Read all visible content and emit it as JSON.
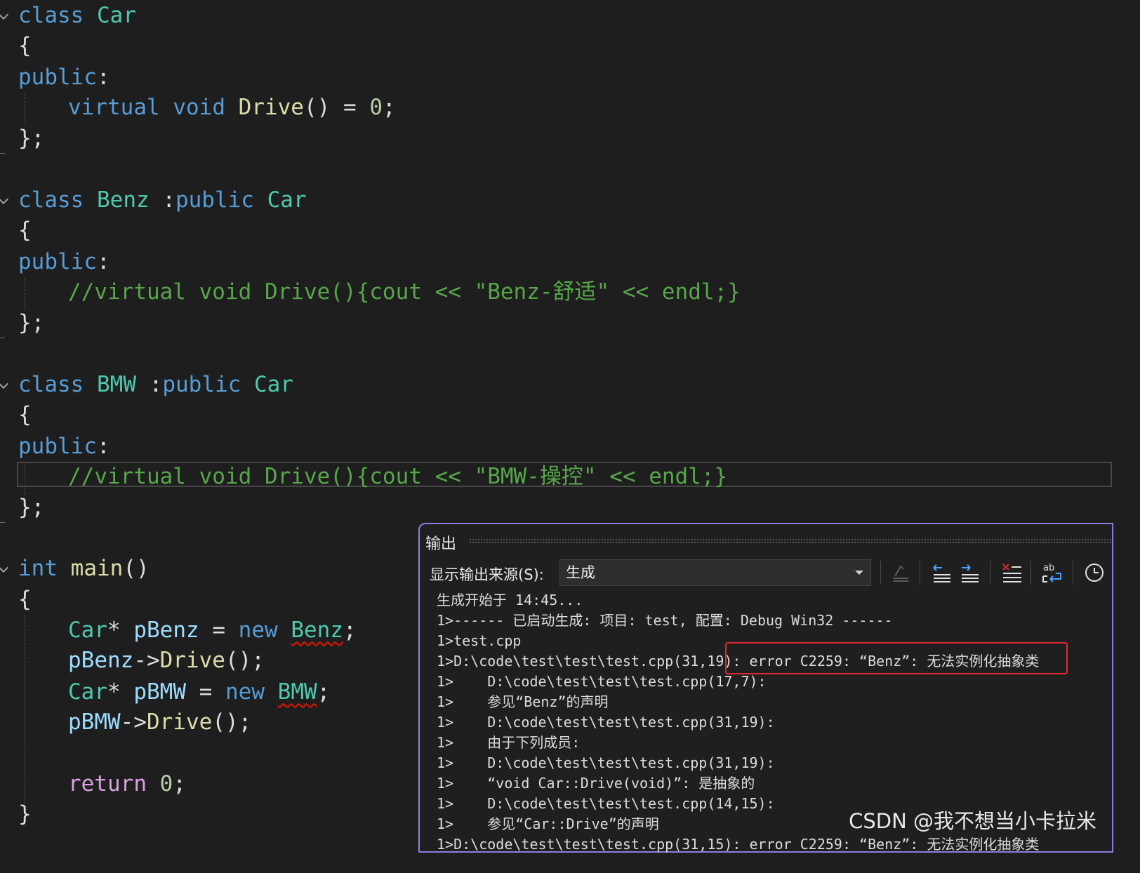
{
  "editor": {
    "car_class": {
      "kw": "class",
      "name": "Car",
      "open": "{",
      "access": "public",
      "colon": ":",
      "virtual": "virtual",
      "void": "void",
      "fn": "Drive",
      "parens": "()",
      "eq": " = ",
      "zero": "0",
      "semi": ";",
      "close": "};"
    },
    "benz_class": {
      "kw": "class",
      "name": "Benz",
      "sep": " :",
      "pub": "public",
      "base": "Car",
      "open": "{",
      "access": "public",
      "colon": ":",
      "comment": "//virtual void Drive(){cout << \"Benz-舒适\" << endl;}",
      "close": "};"
    },
    "bmw_class": {
      "kw": "class",
      "name": "BMW",
      "sep": " :",
      "pub": "public",
      "base": "Car",
      "open": "{",
      "access": "public",
      "colon": ":",
      "comment": "//virtual void Drive(){cout << \"BMW-操控\" << endl;}",
      "close": "};"
    },
    "main_fn": {
      "int": "int",
      "name": "main",
      "parens": "()",
      "open": "{",
      "l1_type": "Car",
      "l1_star": "*",
      "l1_var": "pBenz",
      "l1_eq": " = ",
      "l1_new": "new",
      "l1_cls": "Benz",
      "l1_semi": ";",
      "l2_var": "pBenz",
      "l2_arrow": "->",
      "l2_fn": "Drive",
      "l2_rest": "();",
      "l3_type": "Car",
      "l3_star": "*",
      "l3_var": "pBMW",
      "l3_eq": " = ",
      "l3_new": "new",
      "l3_cls": "BMW",
      "l3_semi": ";",
      "l4_var": "pBMW",
      "l4_arrow": "->",
      "l4_fn": "Drive",
      "l4_rest": "();",
      "ret": "return",
      "ret_val": "0",
      "ret_semi": ";",
      "close": "}"
    }
  },
  "output": {
    "title": "输出",
    "source_label": "显示输出来源(S):",
    "source_value": "生成",
    "lines": [
      "生成开始于 14:45...",
      "1>------ 已启动生成: 项目: test, 配置: Debug Win32 ------",
      "1>test.cpp",
      "1>D:\\code\\test\\test\\test.cpp(31,19): error C2259: “Benz”: 无法实例化抽象类",
      "1>    D:\\code\\test\\test\\test.cpp(17,7):",
      "1>    参见“Benz”的声明",
      "1>    D:\\code\\test\\test\\test.cpp(31,19):",
      "1>    由于下列成员:",
      "1>    D:\\code\\test\\test\\test.cpp(31,19):",
      "1>    “void Car::Drive(void)”: 是抽象的",
      "1>    D:\\code\\test\\test\\test.cpp(14,15):",
      "1>    参见“Car::Drive”的声明",
      "1>D:\\code\\test\\test\\test.cpp(31,15): error C2259: “Benz”: 无法实例化抽象类"
    ],
    "toolbar_icons": [
      "go-to-location-icon",
      "previous-message-icon",
      "next-message-icon",
      "clear-all-icon",
      "word-wrap-icon",
      "history-icon"
    ]
  },
  "watermark": "CSDN @我不想当小卡拉米",
  "colors": {
    "keyword": "#569cd6",
    "type": "#4ec9b0",
    "function": "#dcdcaa",
    "comment": "#57a64a",
    "variable": "#9cdcfe",
    "control": "#d8a0df",
    "error_box": "#e0282e",
    "panel_border": "#8c7ee0"
  }
}
